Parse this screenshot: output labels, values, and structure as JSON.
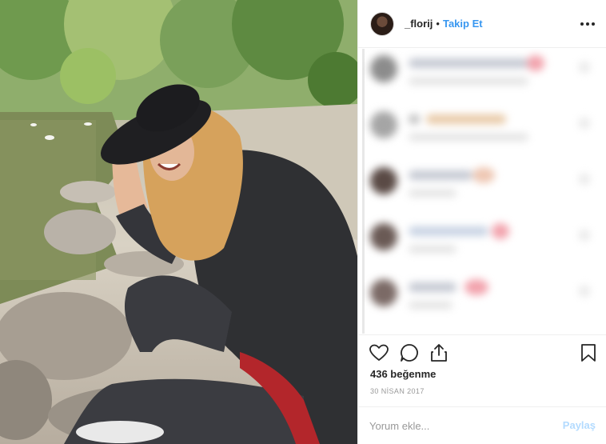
{
  "post": {
    "image_alt": "photo"
  },
  "header": {
    "username": "_florij",
    "separator": "•",
    "follow_label": "Takip Et",
    "more_icon": "more-horizontal-icon"
  },
  "comments": {
    "blurred": true,
    "count_visible": 5
  },
  "actions": {
    "like_icon": "heart-icon",
    "comment_icon": "comment-icon",
    "share_icon": "share-icon",
    "save_icon": "bookmark-icon"
  },
  "likes_text": "436 beğenme",
  "date_text": "30 NİSAN 2017",
  "comment_box": {
    "placeholder": "Yorum ekle...",
    "submit_label": "Paylaş"
  },
  "colors": {
    "accent": "#3897f0",
    "submit_disabled": "#b3dbff",
    "border": "#efefef"
  }
}
